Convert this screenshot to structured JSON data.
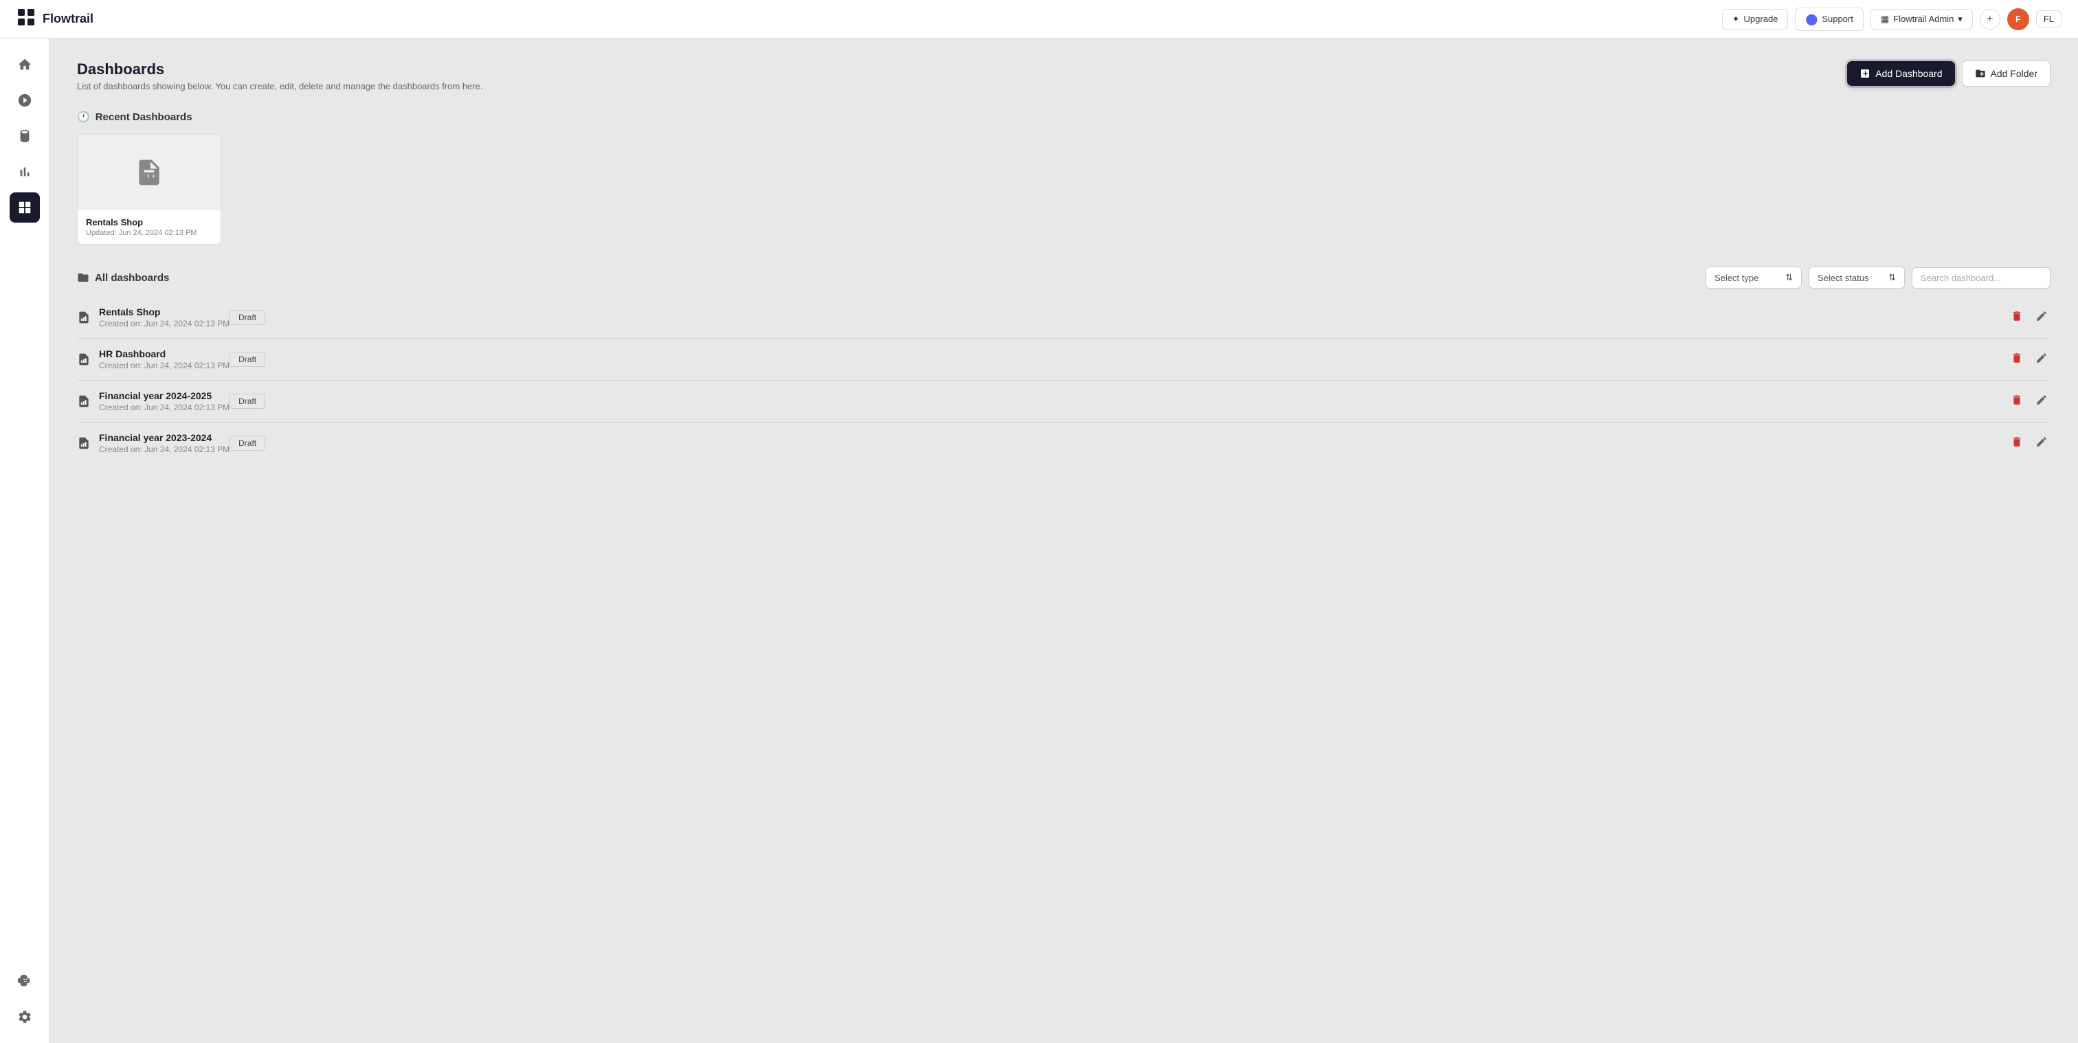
{
  "app": {
    "logo_icon": "⊞",
    "logo_text": "Flowtrail"
  },
  "header": {
    "upgrade_label": "Upgrade",
    "support_label": "Support",
    "admin_label": "Flowtrail Admin",
    "plus_label": "+",
    "avatar_text": "F",
    "user_initials": "FL"
  },
  "sidebar": {
    "items": [
      {
        "id": "home",
        "icon": "⌂",
        "label": "Home"
      },
      {
        "id": "rocket",
        "icon": "✦",
        "label": "Rocket"
      },
      {
        "id": "data",
        "icon": "⊙",
        "label": "Data"
      },
      {
        "id": "charts",
        "icon": "📊",
        "label": "Charts"
      },
      {
        "id": "dashboards",
        "icon": "▣",
        "label": "Dashboards",
        "active": true
      },
      {
        "id": "ai",
        "icon": "🤖",
        "label": "AI"
      },
      {
        "id": "settings",
        "icon": "⚙",
        "label": "Settings"
      }
    ]
  },
  "page": {
    "title": "Dashboards",
    "subtitle": "List of dashboards showing below. You can create, edit, delete and manage the dashboards from here.",
    "add_dashboard_label": "Add Dashboard",
    "add_folder_label": "Add Folder"
  },
  "recent": {
    "section_title": "Recent Dashboards",
    "items": [
      {
        "name": "Rentals Shop",
        "updated": "Updated: Jun 24, 2024 02:13 PM"
      }
    ]
  },
  "all_dashboards": {
    "section_title": "All dashboards",
    "filters": {
      "type_placeholder": "Select type",
      "status_placeholder": "Select status",
      "search_placeholder": "Search dashboard..."
    },
    "items": [
      {
        "name": "Rentals Shop",
        "created": "Created on: Jun 24, 2024 02:13 PM",
        "status": "Draft"
      },
      {
        "name": "HR Dashboard",
        "created": "Created on: Jun 24, 2024 02:13 PM",
        "status": "Draft"
      },
      {
        "name": "Financial year 2024-2025",
        "created": "Created on: Jun 24, 2024 02:13 PM",
        "status": "Draft"
      },
      {
        "name": "Financial year 2023-2024",
        "created": "Created on: Jun 24, 2024 02:13 PM",
        "status": "Draft"
      }
    ]
  }
}
